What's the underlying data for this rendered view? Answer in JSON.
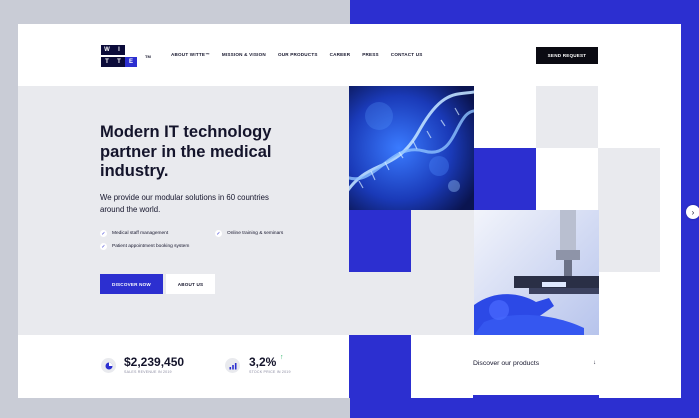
{
  "header": {
    "logo_letters": [
      "W",
      "I",
      "T",
      "T",
      "E"
    ],
    "logo_tm": "TM",
    "nav": [
      "ABOUT WITTE™",
      "MISSION & VISION",
      "OUR PRODUCTS",
      "CAREER",
      "PRESS",
      "CONTACT US"
    ],
    "cta": "SEND REQUEST"
  },
  "hero": {
    "title": "Modern IT technology partner in the medical industry.",
    "subtitle": "We provide our modular solutions in 60 countries around the world.",
    "features": [
      "Medical staff management",
      "Online training & seminars",
      "Patient appointment booking system"
    ],
    "primary_button": "DISCOVER NOW",
    "secondary_button": "ABOUT US"
  },
  "stats": [
    {
      "value": "$2,239,450",
      "label": "SALES REVENUE IN 2019",
      "icon": "pie-chart-icon"
    },
    {
      "value": "3,2%",
      "label": "STOCK PRICE IN 2019",
      "icon": "bar-chart-icon"
    }
  ],
  "products_link": {
    "label": "Discover our products",
    "arrow": "↓"
  },
  "scroll_arrow": "›",
  "colors": {
    "accent": "#2c2fd0",
    "dark": "#0a0a12",
    "light_gray": "#e9eaee",
    "frame": "#c9ccd6",
    "positive": "#2fb36a"
  }
}
